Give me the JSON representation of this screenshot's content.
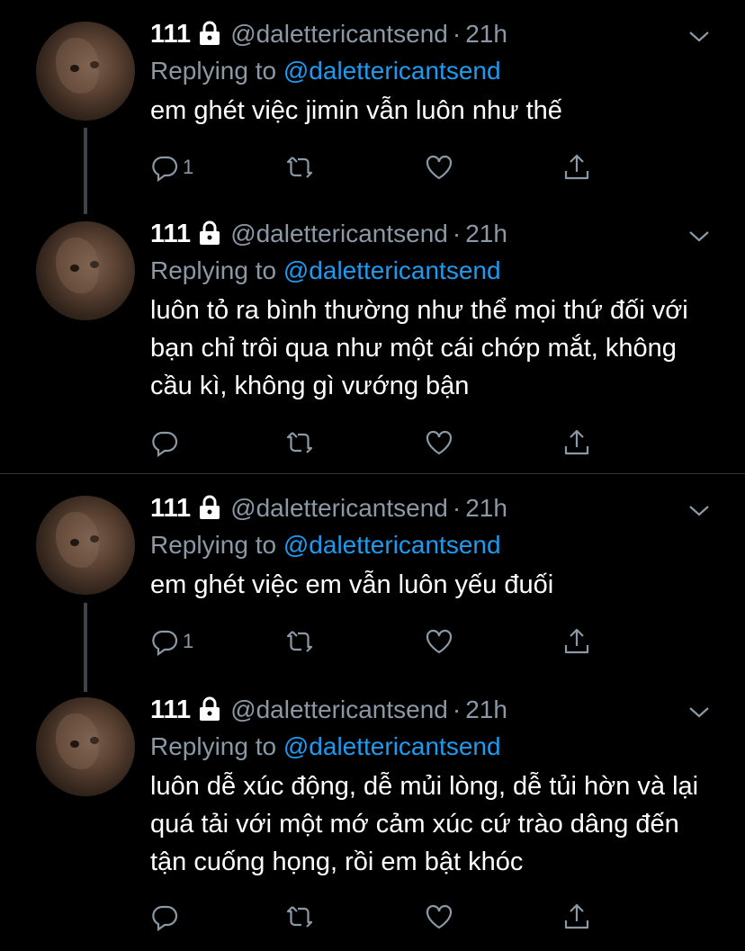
{
  "tweets": [
    {
      "name": "111",
      "handle": "@dalettericantsend",
      "time": "21h",
      "replying_label": "Replying to",
      "replying_to": "@dalettericantsend",
      "text": "em ghét việc jimin vẫn luôn như thế",
      "reply_count": "1"
    },
    {
      "name": "111",
      "handle": "@dalettericantsend",
      "time": "21h",
      "replying_label": "Replying to",
      "replying_to": "@dalettericantsend",
      "text": "luôn tỏ ra bình thường như thể mọi thứ đối với bạn chỉ trôi qua như một cái chớp mắt, không cầu kì, không gì vướng bận",
      "reply_count": ""
    },
    {
      "name": "111",
      "handle": "@dalettericantsend",
      "time": "21h",
      "replying_label": "Replying to",
      "replying_to": "@dalettericantsend",
      "text": "em ghét việc em vẫn luôn yếu đuối",
      "reply_count": "1"
    },
    {
      "name": "111",
      "handle": "@dalettericantsend",
      "time": "21h",
      "replying_label": "Replying to",
      "replying_to": "@dalettericantsend",
      "text": "luôn dễ xúc động, dễ mủi lòng, dễ tủi hờn và lại quá tải với một mớ cảm xúc cứ trào dâng đến tận cuống họng, rồi em bật khóc",
      "reply_count": ""
    }
  ],
  "icons": {
    "lock": "lock-icon",
    "chevron": "chevron-down-icon",
    "reply": "reply-icon",
    "retweet": "retweet-icon",
    "like": "heart-icon",
    "share": "share-icon"
  },
  "colors": {
    "background": "#000000",
    "secondary_text": "#8b98a5",
    "mention": "#1d9bf0",
    "thread_line": "#3d4349",
    "divider": "#2f3336"
  }
}
